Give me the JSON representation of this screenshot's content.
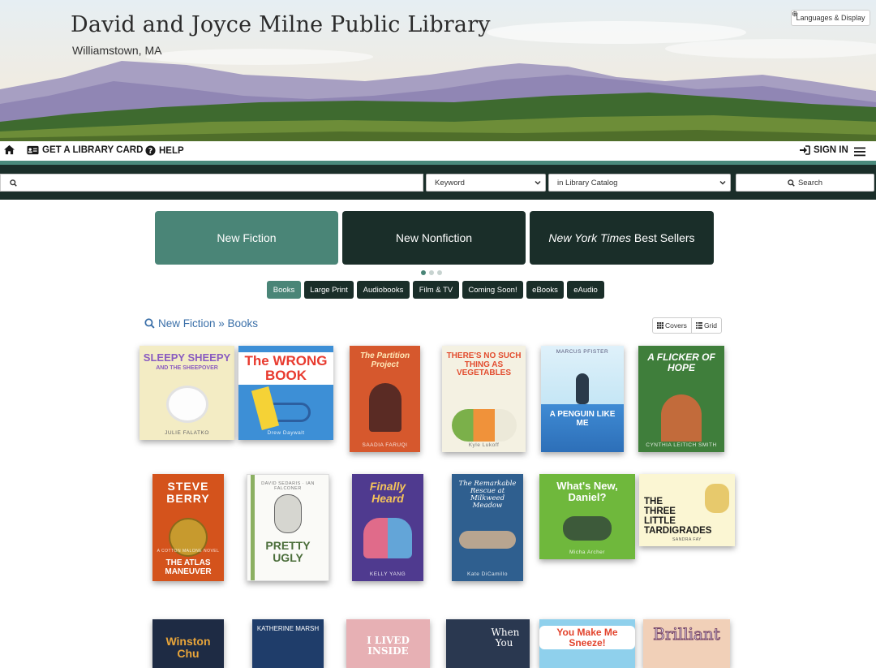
{
  "header": {
    "library_name": "David and Joyce Milne Public Library",
    "location": "Williamstown, MA",
    "languages_label": "Languages & Display"
  },
  "nav": {
    "card_label": "GET A LIBRARY CARD",
    "help_label": "HELP",
    "signin_label": "SIGN IN"
  },
  "search": {
    "query": "",
    "type_selected": "Keyword",
    "scope_selected": "in Library Catalog",
    "button_label": "Search"
  },
  "browse": {
    "categories": [
      {
        "label": "New Fiction",
        "active": true
      },
      {
        "label": "New Nonfiction",
        "active": false
      },
      {
        "label_italic": "New York Times",
        "label_rest": " Best Sellers",
        "active": false
      }
    ],
    "page_count": 3,
    "active_page": 1,
    "formats": [
      {
        "label": "Books",
        "active": true
      },
      {
        "label": "Large Print",
        "active": false
      },
      {
        "label": "Audiobooks",
        "active": false
      },
      {
        "label": "Film & TV",
        "active": false
      },
      {
        "label": "Coming Soon!",
        "active": false
      },
      {
        "label": "eBooks",
        "active": false
      },
      {
        "label": "eAudio",
        "active": false
      }
    ]
  },
  "results": {
    "title": "New Fiction » Books",
    "view_covers": "Covers",
    "view_grid": "Grid",
    "books": [
      {
        "title": "SLEEPY SHEEPY",
        "subtitle": "AND THE SHEEPOVER",
        "byline": "JULIE FALATKO"
      },
      {
        "title": "The WRONG BOOK",
        "subtitle": "",
        "byline": "Drew Daywalt"
      },
      {
        "title": "The Partition Project",
        "subtitle": "",
        "byline": "SAADIA FARUQI"
      },
      {
        "title": "THERE'S NO SUCH THING AS VEGETABLES",
        "subtitle": "",
        "byline": "Kyle Lukoff"
      },
      {
        "title": "A PENGUIN LIKE ME",
        "subtitle": "",
        "byline": "MARCUS PFISTER"
      },
      {
        "title": "A FLICKER OF HOPE",
        "subtitle": "",
        "byline": "CYNTHIA LEITICH SMITH"
      },
      {
        "title": "STEVE BERRY",
        "subtitle": "THE ATLAS MANEUVER",
        "byline": "A COTTON MALONE NOVEL"
      },
      {
        "title": "PRETTY UGLY",
        "subtitle": "",
        "byline": "DAVID SEDARIS · IAN FALCONER"
      },
      {
        "title": "Finally Heard",
        "subtitle": "",
        "byline": "KELLY YANG"
      },
      {
        "title": "The Remarkable Rescue at Milkweed Meadow",
        "subtitle": "",
        "byline": "Kate DiCamillo"
      },
      {
        "title": "What's New, Daniel?",
        "subtitle": "",
        "byline": "Micha Archer"
      },
      {
        "title": "THE THREE LITTLE TARDIGRADES",
        "subtitle": "",
        "byline": "SANDRA FAY"
      },
      {
        "title": "Winston Chu",
        "subtitle": "",
        "byline": ""
      },
      {
        "title": "KATHERINE MARSH",
        "subtitle": "",
        "byline": ""
      },
      {
        "title": "I LIVED INSIDE",
        "subtitle": "",
        "byline": ""
      },
      {
        "title": "When You",
        "subtitle": "",
        "byline": ""
      },
      {
        "title": "You Make Me Sneeze!",
        "subtitle": "",
        "byline": ""
      },
      {
        "title": "Brilliant",
        "subtitle": "",
        "byline": ""
      }
    ]
  },
  "colors": {
    "accent": "#4a8577",
    "dark": "#1a2e29",
    "link": "#3a6fa8"
  },
  "icons": [
    "home-icon",
    "id-card-icon",
    "help-circle-icon",
    "sign-in-icon",
    "menu-icon",
    "search-icon",
    "gear-icon",
    "grid-icon",
    "list-icon",
    "chevron-down-icon"
  ]
}
